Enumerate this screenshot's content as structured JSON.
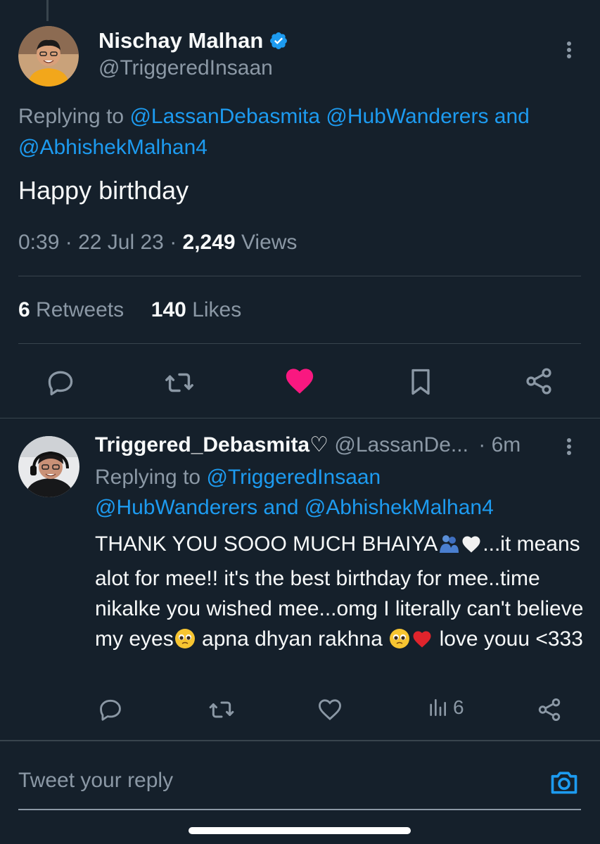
{
  "main_tweet": {
    "author_name": "Nischay Malhan",
    "author_handle": "@TriggeredInsaan",
    "replying_prefix": "Replying to",
    "replying_to_line1": "@LassanDebasmita @HubWanderers and",
    "replying_to_line2": "@AbhishekMalhan4",
    "text": "Happy birthday",
    "time": "0:39",
    "date": "22 Jul 23",
    "views_count": "2,249",
    "views_label": "Views",
    "retweets_count": "6",
    "retweets_label": "Retweets",
    "likes_count": "140",
    "likes_label": "Likes",
    "liked": true
  },
  "reply_tweet": {
    "author_name": "Triggered_Debasmita♡",
    "author_handle": "@LassanDe...",
    "time_ago": "· 6m",
    "replying_prefix": "Replying to",
    "replying_to_line1": "@TriggeredInsaan",
    "replying_to_line2": "@HubWanderers and @AbhishekMalhan4",
    "text_part1": "THANK YOU SOOO MUCH BHAIYA",
    "text_part2": "...it means alot for mee!! it's the best birthday for mee..time nikalke you wished mee...omg I literally can't believe my eyes",
    "text_part3": " apna dhyan rakhna ",
    "text_part4": " love youu <333",
    "views": "6"
  },
  "composer": {
    "placeholder": "Tweet your reply"
  },
  "colors": {
    "background": "#15202b",
    "accent": "#1d9bf0",
    "like": "#f91880",
    "muted": "#8b98a5"
  },
  "icons": {
    "verified": "verified-badge-icon",
    "reply": "reply-icon",
    "retweet": "retweet-icon",
    "like": "heart-icon",
    "bookmark": "bookmark-icon",
    "share": "share-icon",
    "views": "views-icon",
    "camera": "camera-icon",
    "more": "more-vertical-icon"
  }
}
